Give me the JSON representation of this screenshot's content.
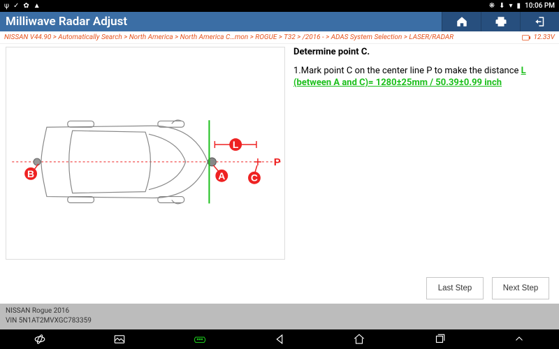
{
  "statusbar": {
    "time": "10:06 PM"
  },
  "titlebar": {
    "title": "Milliwave Radar Adjust"
  },
  "breadcrumbs": {
    "path": "NISSAN V44.90 > Automatically Search > North America > North America C…mon > ROGUE > T32 > /2016 - > ADAS System Selection > LASER/RADAR",
    "voltage": "12.33V"
  },
  "diagram": {
    "labels": {
      "B": "B",
      "A": "A",
      "L": "L",
      "C": "C",
      "P": "P"
    }
  },
  "instructions": {
    "heading": "Determine point C.",
    "step1_prefix": "1.Mark point C on the center line P to make the distance ",
    "step1_highlight": "L (between A and C)= 1280±25mm / 50.39±0.99 inch"
  },
  "buttons": {
    "lastStep": "Last Step",
    "nextStep": "Next Step"
  },
  "vehicle": {
    "line1": "NISSAN Rogue 2016",
    "line2": "VIN 5N1AT2MVXGC783359"
  }
}
